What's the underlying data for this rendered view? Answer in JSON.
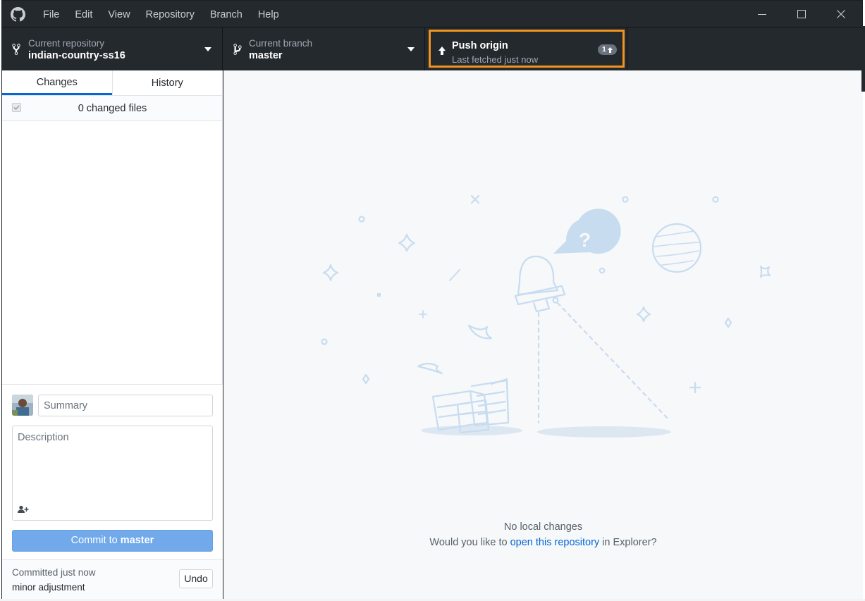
{
  "menu": [
    "File",
    "Edit",
    "View",
    "Repository",
    "Branch",
    "Help"
  ],
  "toolbar": {
    "repo_label": "Current repository",
    "repo_value": "indian-country-ss16",
    "branch_label": "Current branch",
    "branch_value": "master",
    "push_title": "Push origin",
    "push_sub": "Last fetched just now",
    "push_count": "1"
  },
  "sidebar": {
    "tabs": [
      "Changes",
      "History"
    ],
    "changed_files": "0 changed files",
    "summary_placeholder": "Summary",
    "description_placeholder": "Description",
    "commit_prefix": "Commit to ",
    "commit_branch": "master",
    "last_commit_status": "Committed just now",
    "last_commit_message": "minor adjustment",
    "undo_label": "Undo"
  },
  "main": {
    "empty_title": "No local changes",
    "empty_prefix": "Would you like to ",
    "empty_link": "open this repository",
    "empty_suffix": " in Explorer?"
  },
  "colors": {
    "toolbar_bg": "#24292e",
    "push_highlight": "#f0931f",
    "accent": "#0366d6",
    "commit_button": "#71a9ea",
    "illustration": "#c8dcf0"
  }
}
